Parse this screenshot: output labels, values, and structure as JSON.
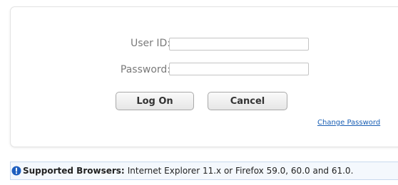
{
  "login_form": {
    "userid_label": "User ID:",
    "userid_value": "",
    "password_label": "Password:",
    "password_value": "",
    "logon_button": "Log On",
    "cancel_button": "Cancel",
    "change_password_link": "Change Password"
  },
  "notice": {
    "icon": "info-icon",
    "label": "Supported Browsers:",
    "text": "Internet Explorer 11.x or Firefox 59.0, 60.0 and 61.0."
  },
  "colors": {
    "link": "#1a5fb4",
    "info_icon": "#1f5fbf",
    "notice_background": "#f4f8fd"
  }
}
